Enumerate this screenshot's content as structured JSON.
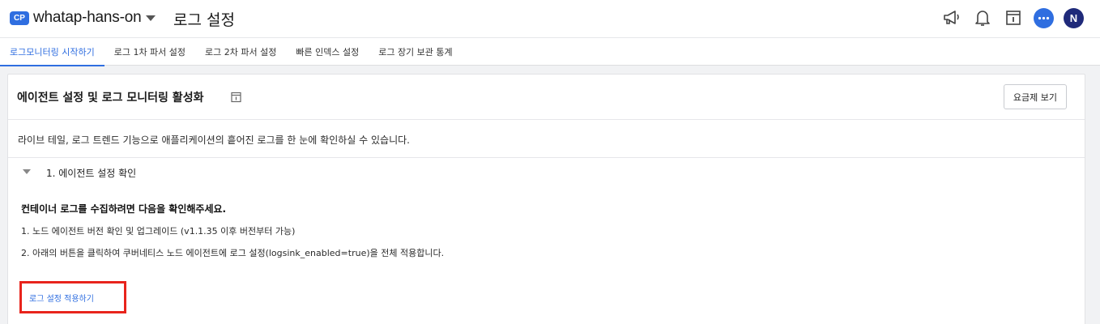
{
  "header": {
    "badge": "CP",
    "project": "whatap-hans-on",
    "page_title": "로그 설정",
    "avatar_initial": "N",
    "icons": [
      "megaphone-icon",
      "bell-icon",
      "document-info-icon",
      "chat-icon"
    ]
  },
  "tabs": [
    {
      "label": "로그모니터링 시작하기",
      "active": true
    },
    {
      "label": "로그 1차 파서 설정",
      "active": false
    },
    {
      "label": "로그 2차 파서 설정",
      "active": false
    },
    {
      "label": "빠른 인덱스 설정",
      "active": false
    },
    {
      "label": "로그 장기 보관 통계",
      "active": false
    }
  ],
  "card": {
    "title": "에이전트 설정 및 로그 모니터링 활성화",
    "pricing_button": "요금제 보기",
    "description": "라이브 테일, 로그 트렌드 기능으로 애플리케이션의 흩어진 로그를 한 눈에 확인하실 수 있습니다.",
    "section": {
      "title": "1. 에이전트 설정 확인",
      "subtitle": "컨테이너 로그를 수집하려면 다음을 확인해주세요.",
      "steps": [
        "1. 노드 에이전트 버전 확인 및 업그레이드 (v1.1.35 이후 버전부터 가능)",
        "2. 아래의 버튼을 클릭하여 쿠버네티스 노드 에이전트에 로그 설정(logsink_enabled=true)을 전체 적용합니다."
      ],
      "apply_button": "로그 설정 적용하기"
    }
  },
  "colors": {
    "accent": "#2f6ee0",
    "highlight": "#e8241c",
    "avatar": "#1f2a7a"
  }
}
